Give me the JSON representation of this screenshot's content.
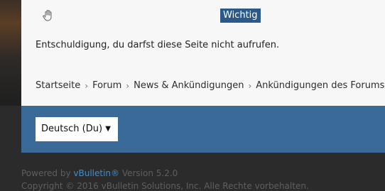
{
  "badge": "Wichtig",
  "message": "Entschuldigung, du darfst diese Seite nicht aufrufen.",
  "breadcrumb": [
    "Startseite",
    "Forum",
    "News & Ankündigungen",
    "Ankündigungen des Forums"
  ],
  "language_select": {
    "selected": "Deutsch (Du)"
  },
  "footer": {
    "powered_prefix": "Powered by ",
    "brand": "vBulletin®",
    "version": " Version 5.2.0",
    "copyright": "Copyright © 2016 vBulletin Solutions, Inc. Alle Rechte vorbehalten."
  },
  "colors": {
    "accent": "#2b5a8a",
    "footer_bar": "#3a6a98",
    "link": "#3f8dd0"
  },
  "icons": {
    "hand": "hand-stop-icon",
    "caret": "chevron-down-icon"
  }
}
